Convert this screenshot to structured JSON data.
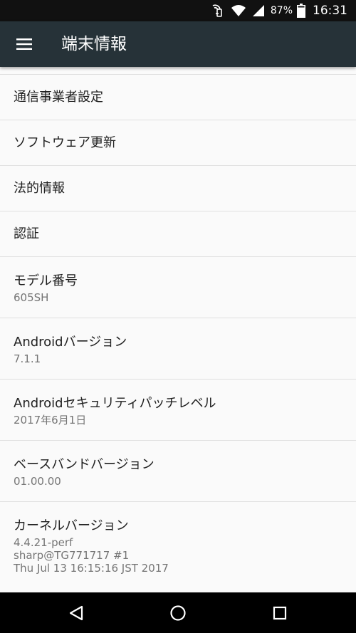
{
  "status_bar": {
    "battery_percent": "87%",
    "time": "16:31",
    "icons": [
      "nfc-icon",
      "wifi-icon",
      "signal-icon",
      "battery-icon"
    ]
  },
  "app_bar": {
    "menu_icon": "menu-icon",
    "title": "端末情報"
  },
  "items": {
    "carrier": {
      "title": "通信事業者設定"
    },
    "software_update": {
      "title": "ソフトウェア更新"
    },
    "legal": {
      "title": "法的情報"
    },
    "certification": {
      "title": "認証"
    },
    "model": {
      "title": "モデル番号",
      "value": "605SH"
    },
    "android_version": {
      "title": "Androidバージョン",
      "value": "7.1.1"
    },
    "security_patch": {
      "title": "Androidセキュリティパッチレベル",
      "value": "2017年6月1日"
    },
    "baseband": {
      "title": "ベースバンドバージョン",
      "value": "01.00.00"
    },
    "kernel": {
      "title": "カーネルバージョン",
      "lines": [
        "4.4.21-perf",
        "sharp@TG771717 #1",
        "Thu Jul 13 16:15:16 JST 2017"
      ]
    }
  },
  "nav_bar": {
    "icons": [
      "back-icon",
      "home-icon",
      "recents-icon"
    ]
  },
  "colors": {
    "app_bar": "#263238",
    "status_bar": "#111111",
    "background": "#fafafa",
    "divider": "#e0e0e0",
    "title_text": "#212121",
    "summary_text": "#757575"
  }
}
